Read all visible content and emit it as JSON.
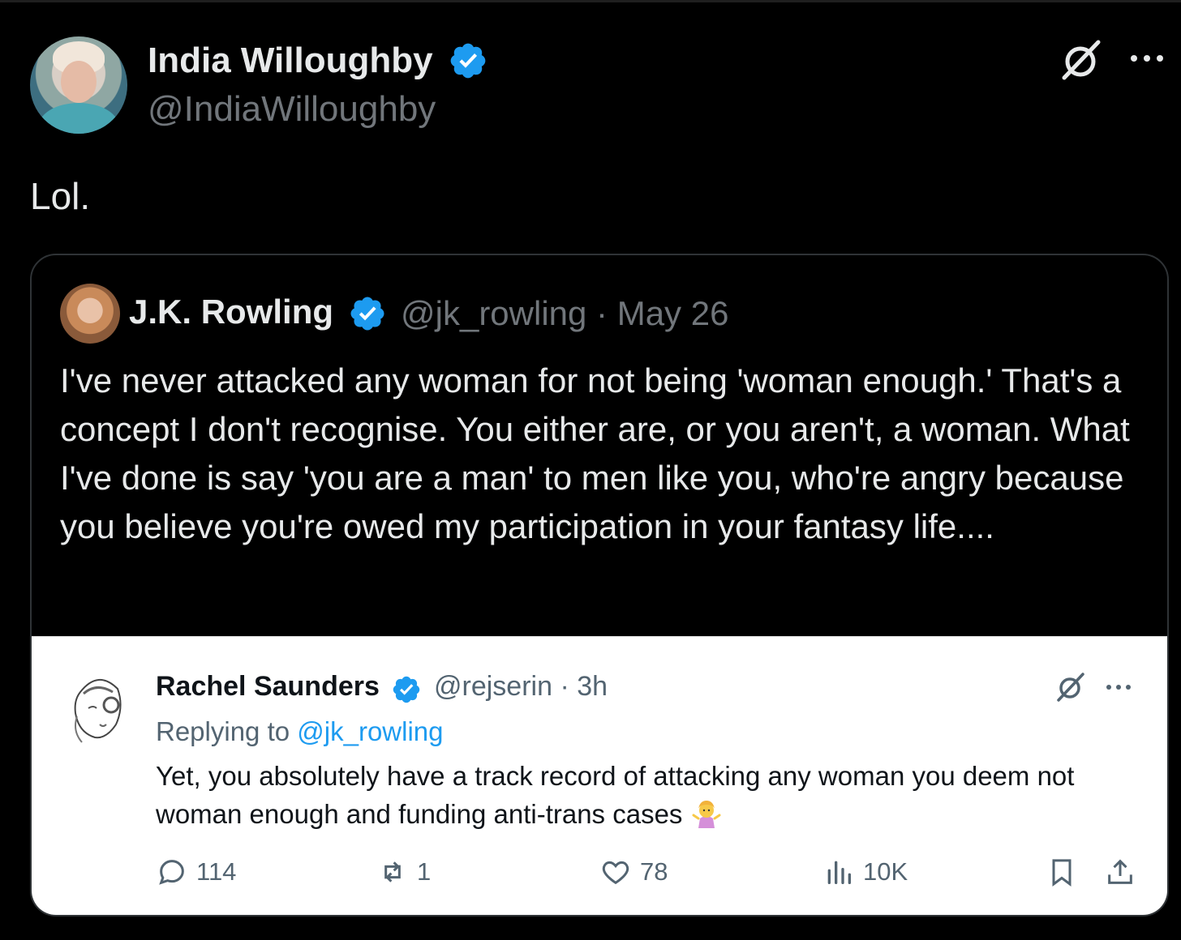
{
  "main_tweet": {
    "author_name": "India Willoughby",
    "author_handle": "@IndiaWilloughby",
    "text": "Lol."
  },
  "quoted_tweet": {
    "author_name": "J.K. Rowling",
    "meta": "@jk_rowling · May 26",
    "text": "I've never attacked any woman for not being 'woman enough.' That's a concept I don't recognise. You either are, or you aren't, a woman. What I've done is say 'you are a man' to men like you, who're angry because you believe you're owed my participation in your fantasy life...."
  },
  "embedded_reply": {
    "author_name": "Rachel Saunders",
    "meta": "@rejserin · 3h",
    "replying_prefix": "Replying to ",
    "replying_mention": "@jk_rowling",
    "text": "Yet, you absolutely have a track record of attacking any woman you deem not woman enough and funding anti-trans cases",
    "emoji": "woman-shrugging-emoji",
    "actions": {
      "replies": "114",
      "reposts": "1",
      "likes": "78",
      "views": "10K"
    }
  },
  "colors": {
    "background": "#000000",
    "verified_blue": "#1d9bf0",
    "muted_dark": "#71767b",
    "muted_light": "#536471"
  }
}
